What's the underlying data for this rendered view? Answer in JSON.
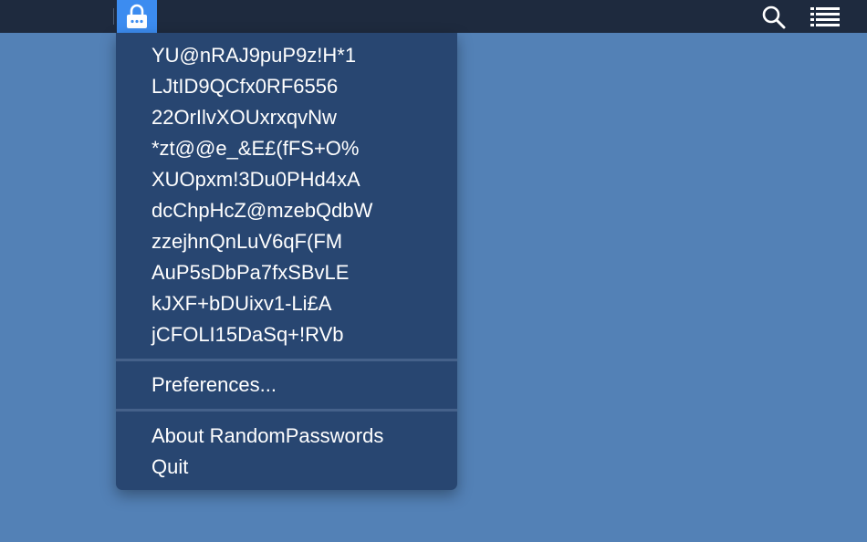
{
  "menubar": {
    "app_icon": "lock-icon",
    "right_icons": [
      "search-icon",
      "list-icon"
    ]
  },
  "menu": {
    "passwords": [
      "YU@nRAJ9puP9z!H*1",
      "LJtID9QCfx0RF6556",
      "22OrIlvXOUxrxqvNw",
      "*zt@@e_&E£(fFS+O%",
      "XUOpxm!3Du0PHd4xA",
      "dcChpHcZ@mzebQdbW",
      "zzejhnQnLuV6qF(FM",
      "AuP5sDbPa7fxSBvLE",
      "kJXF+bDUixv1-Li£A",
      "jCFOLI15DaSq+!RVb"
    ],
    "preferences_label": "Preferences...",
    "about_label": "About RandomPasswords",
    "quit_label": "Quit"
  },
  "colors": {
    "desktop": "#5381b6",
    "menubar": "#1e2a3e",
    "menu_background": "#284671",
    "highlight": "#3c8cf0",
    "text": "#ffffff"
  }
}
